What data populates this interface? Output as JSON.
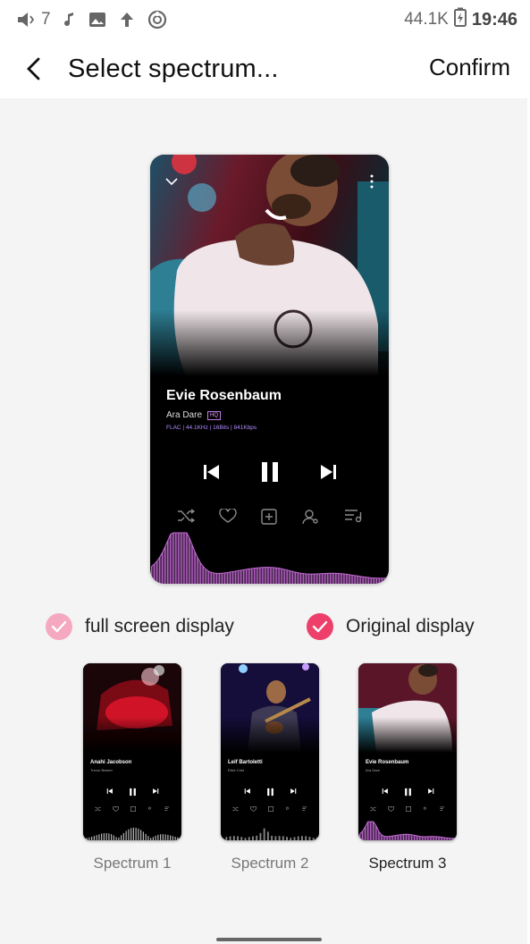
{
  "status_bar": {
    "notification_count": "7",
    "speed": "44.1K",
    "time": "19:46"
  },
  "header": {
    "title": "Select spectrum...",
    "confirm_label": "Confirm"
  },
  "preview": {
    "song_title": "Evie Rosenbaum",
    "artist": "Ara Dare",
    "quality_badge": "HQ",
    "meta": "FLAC | 44.1KHz | 16Bits | 841Kbps"
  },
  "display_options": {
    "full_screen_label": "full screen display",
    "original_label": "Original display",
    "full_screen_checked": true,
    "original_checked": true
  },
  "spectrums": [
    {
      "label": "Spectrum 1",
      "song": "Anahi Jacobson",
      "artist": "Trevor Becker",
      "selected": false
    },
    {
      "label": "Spectrum 2",
      "song": "Leif Bartoletti",
      "artist": "Elsie Crist",
      "selected": false
    },
    {
      "label": "Spectrum 3",
      "song": "Evie Rosenbaum",
      "artist": "Ara Dare",
      "selected": true
    }
  ],
  "colors": {
    "accent": "#ee3f6a",
    "accent_light": "#f5a9c0",
    "spectrum_purple": "#c66bd6"
  }
}
